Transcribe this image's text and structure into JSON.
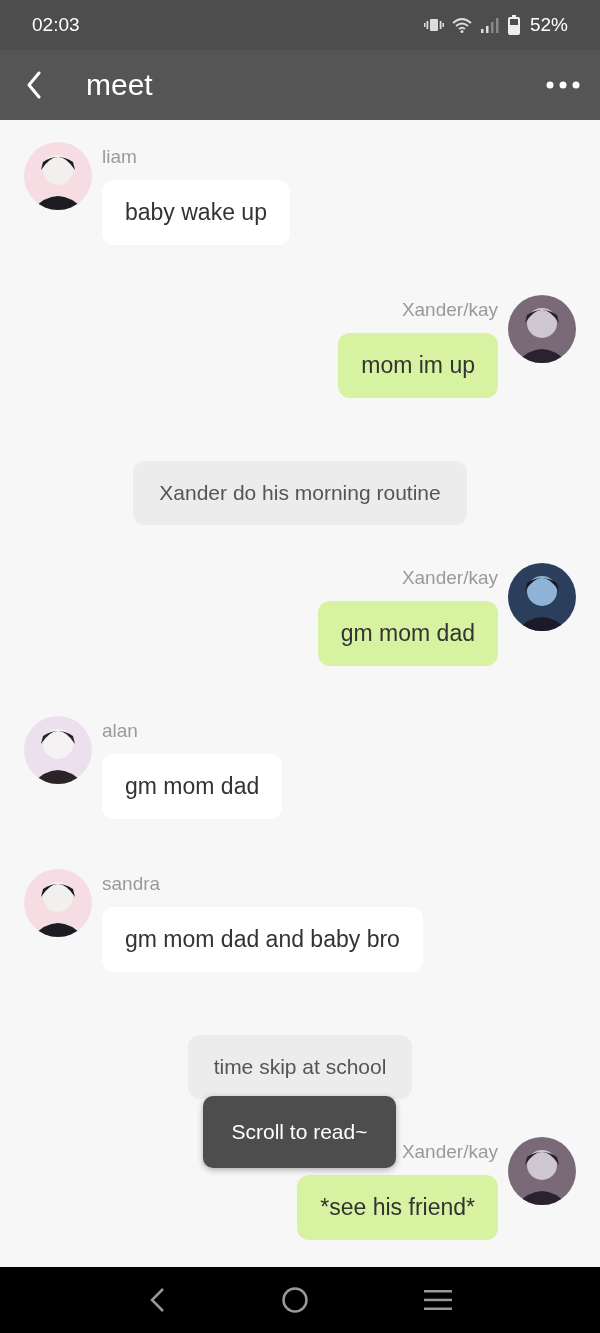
{
  "status_bar": {
    "time": "02:03",
    "battery": "52%"
  },
  "header": {
    "title": "meet"
  },
  "messages": [
    {
      "kind": "received",
      "sender": "liam",
      "text": "baby wake up"
    },
    {
      "kind": "sent",
      "sender": "Xander/kay",
      "text": "mom im up"
    },
    {
      "kind": "narration",
      "text": "Xander do his morning routine"
    },
    {
      "kind": "sent",
      "sender": "Xander/kay",
      "text": "gm mom dad"
    },
    {
      "kind": "received",
      "sender": "alan",
      "text": "gm mom dad"
    },
    {
      "kind": "received",
      "sender": "sandra",
      "text": "gm mom dad and baby bro"
    },
    {
      "kind": "narration",
      "text": "time skip at school"
    },
    {
      "kind": "sent",
      "sender": "Xander/kay",
      "text": "*see his friend*"
    }
  ],
  "toast": {
    "text": "Scroll to read~"
  }
}
